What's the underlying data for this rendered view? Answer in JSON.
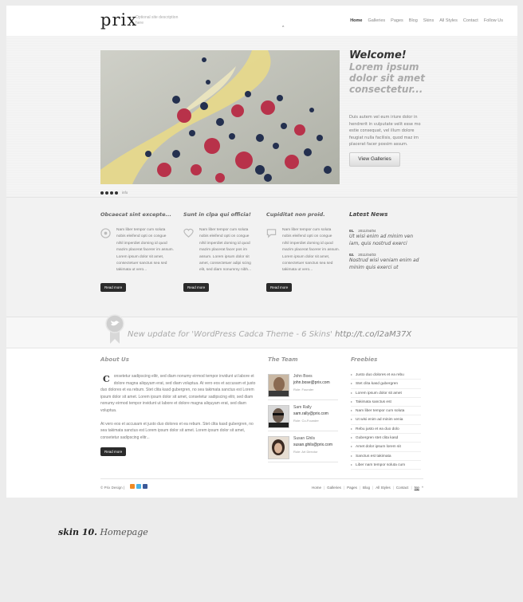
{
  "header": {
    "logo": "prix",
    "tagline": "Optional site description here",
    "nav": [
      "Home",
      "Galleries",
      "Pages",
      "Blog",
      "Skins",
      "All Styles",
      "Contact",
      "Follow Us"
    ]
  },
  "hero": {
    "welcome": "Welcome!",
    "subtitle": "Lorem ipsum dolor sit amet consectetur...",
    "text": "Duis autem vel eum iriure dolor in hendrerit in vulputate velit esse mo estie consequat, vel illum dolore feugiat nulla facilisis, quod maz im placerat facer possim assum.",
    "button": "View Galleries",
    "slide_info": "info"
  },
  "features": [
    {
      "title": "Obcaecat sint excepte...",
      "text": "Nam liber tempor cum soluta nobis eleifend opti on congue nihil imperdiet doming id quod mazim placerat facerer im assum. Lorem ipsum dolor sit amet, consectetuer sanctus sea sed takimata ut vero...",
      "button": "Read more"
    },
    {
      "title": "Sunt in clpa qui officia!",
      "text": "Nam liber tempor cum soluta nobis eleifend opti on congue nihil imperdiet doming id quod mazim placerat facer pos im assum. Lorem ipsum dolor sit amet, consectetuer adipi scing elit, sed diam nonummy nibh...",
      "button": "Read more"
    },
    {
      "title": "Cupiditat non proid.",
      "text": "Nam liber tempor cum soluta nobis eleifend opti on congue nihil imperdiet doming id quod mazim placerat facerer im assum. Lorem ipsum dolor sit amet, consectetuer sanctus sea sed takimata ut vero...",
      "button": "Read more"
    }
  ],
  "news": {
    "heading": "Latest News",
    "items": [
      {
        "num": "01.",
        "date": "2011/04/04",
        "title": "Ut wisi enim ad minim ven iam, quis nostrud exerci"
      },
      {
        "num": "02.",
        "date": "2011/04/03",
        "title": "Nostrud wisi veniam enim ad minim quis exerci ut"
      }
    ]
  },
  "tweet": {
    "text": "New update for 'WordPress Cadca Theme - 6 Skins' ",
    "link": "http://t.co/l2aM37X"
  },
  "about": {
    "heading": "About Us",
    "dropcap": "C",
    "p1": "onsetetur sadipscing elitr, sed diam nonumy eirmod tempor invidunt ut labore et dolore magna aliquyam erat, sed diam voluptua. At vero eos et accusam et justo duo dolores et ea rebum. Stet clita kasd gubergren, no sea takimata sanctus est Lorem ipsum dolor sit amet. Lorem ipsum dolor sit amet, consetetur sadipscing elitr, sed diam nonumy eirmod tempor invidunt ut labore et dolore magna aliquyam erat, sed diam voluptua.",
    "p2": "At vero eos et accusam et justo duo dolores et ea rebum. Stet clita kasd gubergren, no sea takimata sanctus est Lorem ipsum dolor sit amet. Lorem ipsum dolor sit amet, consetetur sadipscing elitr...",
    "button": "Read more"
  },
  "team": {
    "heading": "The Team",
    "members": [
      {
        "name": "John Boes",
        "email": "john.bose@prix.com",
        "role": "Role: Founder"
      },
      {
        "name": "Sam Rally",
        "email": "sam.rally@prix.com",
        "role": "Role: Co-Founder"
      },
      {
        "name": "Susan Ghils",
        "email": "susan.ghils@prix.com",
        "role": "Role: Art Director"
      }
    ]
  },
  "freebies": {
    "heading": "Freebies",
    "items": [
      "Justo duo dolores et ea rebu",
      "Stet clita kasd gubergren",
      "Lorem ipsum dolor sit amet",
      "Takimata sanctus est",
      "Nam liber tempor cum soluta",
      "Ut wisi enim ad minim venia",
      "Rebu justo et ea duo dolo",
      "Gubergren stet clita kasd",
      "Amet dolor ipsum lorem sit",
      "Sanctus est takimata",
      "Liber nam tempor soluta cum"
    ]
  },
  "footer": {
    "copy": "© Prix Design |",
    "links": [
      "Home",
      "Galleries",
      "Pages",
      "Blog",
      "All Styles",
      "Contact",
      "top"
    ]
  },
  "caption": {
    "bold": "skin 10.",
    "rest": " Homepage"
  }
}
